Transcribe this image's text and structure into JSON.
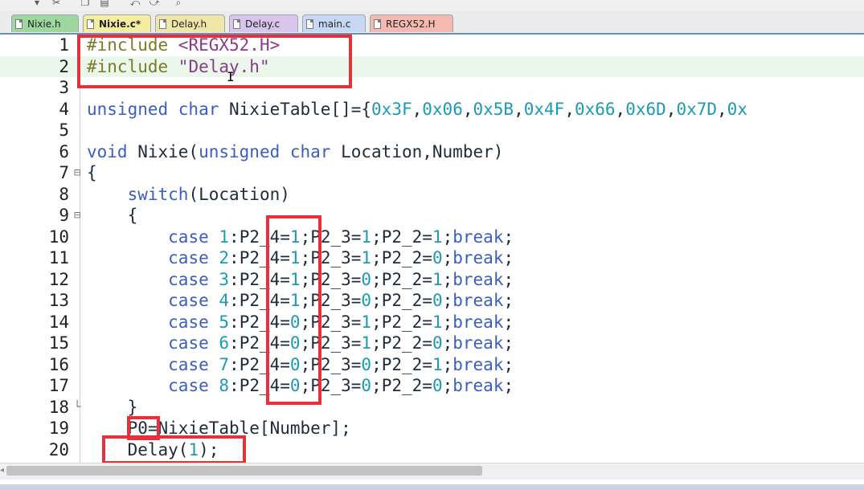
{
  "toolbar": {
    "icons": [
      "dropdown-icon",
      "scissors-icon",
      "copy-icon",
      "paste-icon",
      "undo-icon",
      "redo-icon",
      "find-icon"
    ]
  },
  "tabs": [
    {
      "label": "Nixie.h",
      "active": false,
      "color": "#9ed79e"
    },
    {
      "label": "Nixie.c*",
      "active": true,
      "color": "#f5ec9e"
    },
    {
      "label": "Delay.h",
      "active": false,
      "color": "#f0e6a8"
    },
    {
      "label": "Delay.c",
      "active": false,
      "color": "#d9c4ec"
    },
    {
      "label": "main.c",
      "active": false,
      "color": "#c7d8f4"
    },
    {
      "label": "REGX52.H",
      "active": false,
      "color": "#f6b9b0"
    }
  ],
  "editor": {
    "lines": [
      {
        "n": "1",
        "fold": "",
        "segs": [
          [
            "pp",
            "#include "
          ],
          [
            "str",
            "<REGX52.H>"
          ]
        ]
      },
      {
        "n": "2",
        "fold": "",
        "segs": [
          [
            "pp",
            "#include "
          ],
          [
            "str",
            "\"Delay.h\""
          ]
        ]
      },
      {
        "n": "3",
        "fold": "",
        "segs": []
      },
      {
        "n": "4",
        "fold": "",
        "segs": [
          [
            "kw",
            "unsigned char"
          ],
          [
            "",
            " NixieTable[]={"
          ],
          [
            "num",
            "0x3F"
          ],
          [
            "",
            ","
          ],
          [
            "num",
            "0x06"
          ],
          [
            "",
            ","
          ],
          [
            "num",
            "0x5B"
          ],
          [
            "",
            ","
          ],
          [
            "num",
            "0x4F"
          ],
          [
            "",
            ","
          ],
          [
            "num",
            "0x66"
          ],
          [
            "",
            ","
          ],
          [
            "num",
            "0x6D"
          ],
          [
            "",
            ","
          ],
          [
            "num",
            "0x7D"
          ],
          [
            "",
            ","
          ],
          [
            "num",
            "0x"
          ]
        ]
      },
      {
        "n": "5",
        "fold": "",
        "segs": []
      },
      {
        "n": "6",
        "fold": "",
        "segs": [
          [
            "kw",
            "void"
          ],
          [
            "",
            " Nixie("
          ],
          [
            "kw",
            "unsigned char"
          ],
          [
            "",
            " Location,Number)"
          ]
        ]
      },
      {
        "n": "7",
        "fold": "⊟",
        "segs": [
          [
            "",
            "{"
          ]
        ]
      },
      {
        "n": "8",
        "fold": "",
        "segs": [
          [
            "",
            "    "
          ],
          [
            "kw",
            "switch"
          ],
          [
            "",
            "(Location)"
          ]
        ]
      },
      {
        "n": "9",
        "fold": "⊟",
        "segs": [
          [
            "",
            "    {"
          ]
        ]
      },
      {
        "n": "10",
        "fold": "",
        "segs": [
          [
            "",
            "        "
          ],
          [
            "kw",
            "case"
          ],
          [
            "",
            " "
          ],
          [
            "num",
            "1"
          ],
          [
            "",
            ":P2_4="
          ],
          [
            "num",
            "1"
          ],
          [
            "",
            ";P2_3="
          ],
          [
            "num",
            "1"
          ],
          [
            "",
            ";P2_2="
          ],
          [
            "num",
            "1"
          ],
          [
            "",
            ";"
          ],
          [
            "kw",
            "break"
          ],
          [
            "",
            ";"
          ]
        ]
      },
      {
        "n": "11",
        "fold": "",
        "segs": [
          [
            "",
            "        "
          ],
          [
            "kw",
            "case"
          ],
          [
            "",
            " "
          ],
          [
            "num",
            "2"
          ],
          [
            "",
            ":P2_4="
          ],
          [
            "num",
            "1"
          ],
          [
            "",
            ";P2_3="
          ],
          [
            "num",
            "1"
          ],
          [
            "",
            ";P2_2="
          ],
          [
            "num",
            "0"
          ],
          [
            "",
            ";"
          ],
          [
            "kw",
            "break"
          ],
          [
            "",
            ";"
          ]
        ]
      },
      {
        "n": "12",
        "fold": "",
        "segs": [
          [
            "",
            "        "
          ],
          [
            "kw",
            "case"
          ],
          [
            "",
            " "
          ],
          [
            "num",
            "3"
          ],
          [
            "",
            ":P2_4="
          ],
          [
            "num",
            "1"
          ],
          [
            "",
            ";P2_3="
          ],
          [
            "num",
            "0"
          ],
          [
            "",
            ";P2_2="
          ],
          [
            "num",
            "1"
          ],
          [
            "",
            ";"
          ],
          [
            "kw",
            "break"
          ],
          [
            "",
            ";"
          ]
        ]
      },
      {
        "n": "13",
        "fold": "",
        "segs": [
          [
            "",
            "        "
          ],
          [
            "kw",
            "case"
          ],
          [
            "",
            " "
          ],
          [
            "num",
            "4"
          ],
          [
            "",
            ":P2_4="
          ],
          [
            "num",
            "1"
          ],
          [
            "",
            ";P2_3="
          ],
          [
            "num",
            "0"
          ],
          [
            "",
            ";P2_2="
          ],
          [
            "num",
            "0"
          ],
          [
            "",
            ";"
          ],
          [
            "kw",
            "break"
          ],
          [
            "",
            ";"
          ]
        ]
      },
      {
        "n": "14",
        "fold": "",
        "segs": [
          [
            "",
            "        "
          ],
          [
            "kw",
            "case"
          ],
          [
            "",
            " "
          ],
          [
            "num",
            "5"
          ],
          [
            "",
            ":P2_4="
          ],
          [
            "num",
            "0"
          ],
          [
            "",
            ";P2_3="
          ],
          [
            "num",
            "1"
          ],
          [
            "",
            ";P2_2="
          ],
          [
            "num",
            "1"
          ],
          [
            "",
            ";"
          ],
          [
            "kw",
            "break"
          ],
          [
            "",
            ";"
          ]
        ]
      },
      {
        "n": "15",
        "fold": "",
        "segs": [
          [
            "",
            "        "
          ],
          [
            "kw",
            "case"
          ],
          [
            "",
            " "
          ],
          [
            "num",
            "6"
          ],
          [
            "",
            ":P2_4="
          ],
          [
            "num",
            "0"
          ],
          [
            "",
            ";P2_3="
          ],
          [
            "num",
            "1"
          ],
          [
            "",
            ";P2_2="
          ],
          [
            "num",
            "0"
          ],
          [
            "",
            ";"
          ],
          [
            "kw",
            "break"
          ],
          [
            "",
            ";"
          ]
        ]
      },
      {
        "n": "16",
        "fold": "",
        "segs": [
          [
            "",
            "        "
          ],
          [
            "kw",
            "case"
          ],
          [
            "",
            " "
          ],
          [
            "num",
            "7"
          ],
          [
            "",
            ":P2_4="
          ],
          [
            "num",
            "0"
          ],
          [
            "",
            ";P2_3="
          ],
          [
            "num",
            "0"
          ],
          [
            "",
            ";P2_2="
          ],
          [
            "num",
            "1"
          ],
          [
            "",
            ";"
          ],
          [
            "kw",
            "break"
          ],
          [
            "",
            ";"
          ]
        ]
      },
      {
        "n": "17",
        "fold": "",
        "segs": [
          [
            "",
            "        "
          ],
          [
            "kw",
            "case"
          ],
          [
            "",
            " "
          ],
          [
            "num",
            "8"
          ],
          [
            "",
            ":P2_4="
          ],
          [
            "num",
            "0"
          ],
          [
            "",
            ";P2_3="
          ],
          [
            "num",
            "0"
          ],
          [
            "",
            ";P2_2="
          ],
          [
            "num",
            "0"
          ],
          [
            "",
            ";"
          ],
          [
            "kw",
            "break"
          ],
          [
            "",
            ";"
          ]
        ]
      },
      {
        "n": "18",
        "fold": "└",
        "segs": [
          [
            "",
            "    }"
          ]
        ]
      },
      {
        "n": "19",
        "fold": "",
        "segs": [
          [
            "",
            "    P0=NixieTable[Number];"
          ]
        ]
      },
      {
        "n": "20",
        "fold": "",
        "segs": [
          [
            "",
            "    Delay("
          ],
          [
            "num",
            "1"
          ],
          [
            "",
            ");"
          ]
        ]
      }
    ]
  }
}
